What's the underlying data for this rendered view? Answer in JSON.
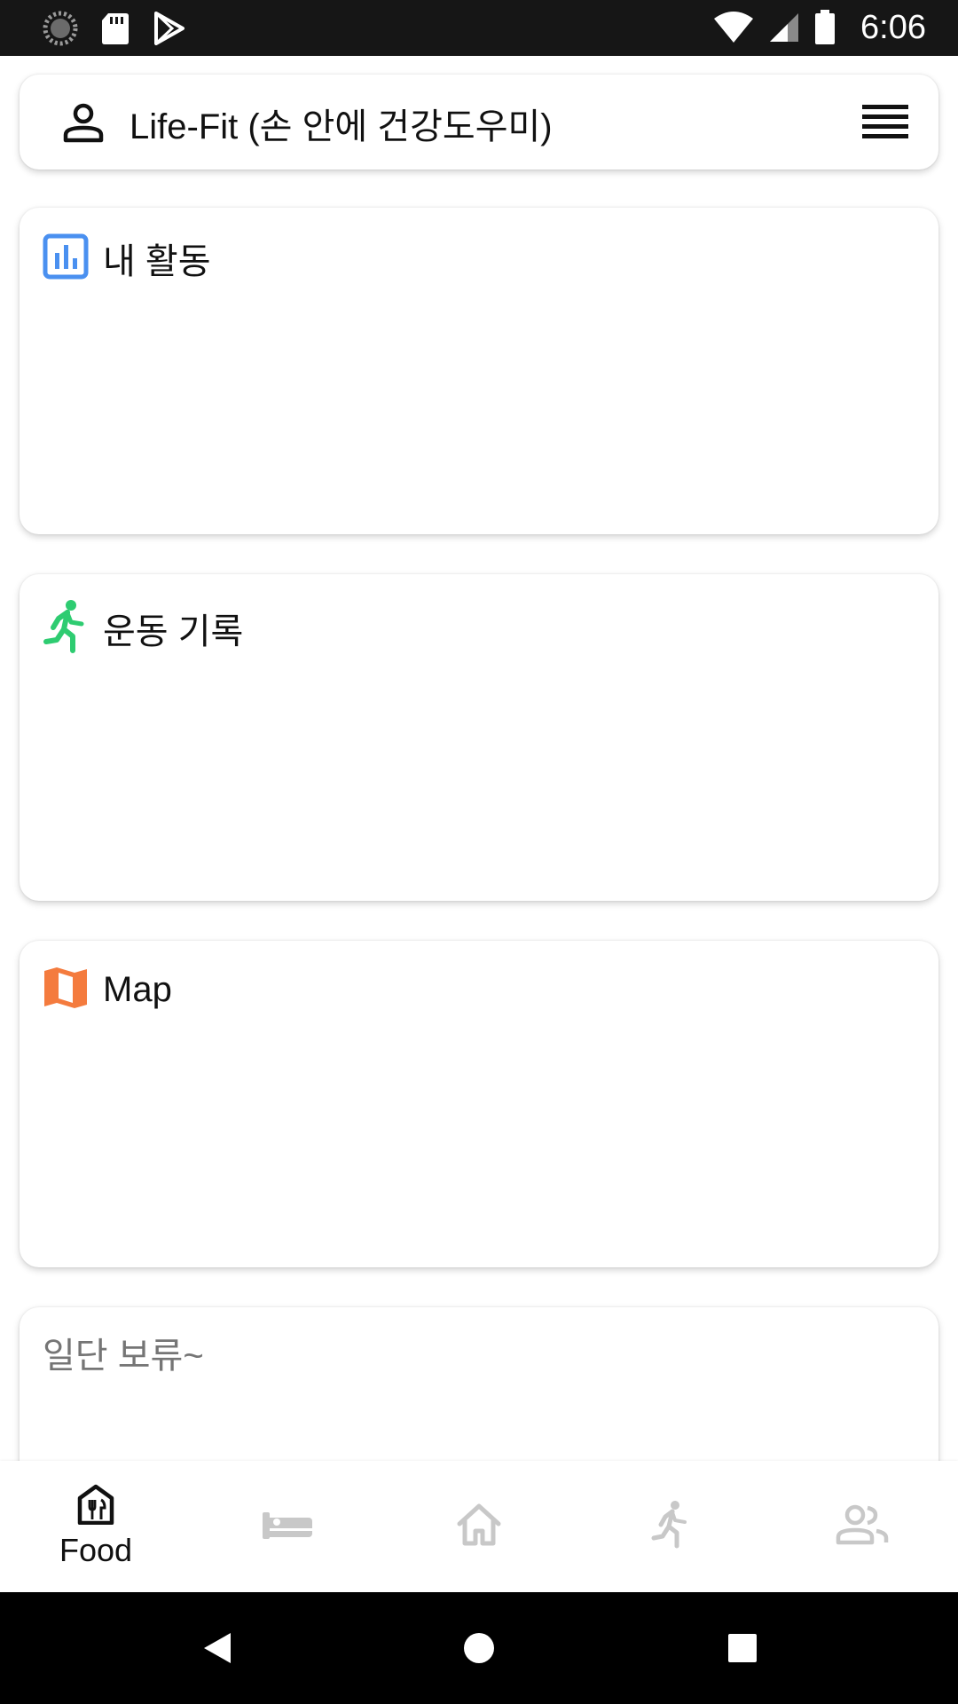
{
  "status_bar": {
    "time": "6:06",
    "icons": [
      "sync-icon",
      "sd-card-icon",
      "play-store-icon",
      "wifi-icon",
      "signal-icon",
      "battery-icon"
    ]
  },
  "header": {
    "title": "Life-Fit (손 안에 건강도우미)",
    "icons": [
      "user-icon",
      "menu-icon"
    ]
  },
  "cards": [
    {
      "title": "내 활동",
      "icon": "bar-chart-icon",
      "icon_color": "#4a90f0"
    },
    {
      "title": "운동 기록",
      "icon": "running-icon",
      "icon_color": "#2ecc71"
    },
    {
      "title": "Map",
      "icon": "map-icon",
      "icon_color": "#f47b3e"
    },
    {
      "title": "일단 보류~",
      "icon": "",
      "text_color": "#757575"
    }
  ],
  "bottom_nav": {
    "items": [
      {
        "label": "Food",
        "icon": "food-icon",
        "active": true
      },
      {
        "label": "",
        "icon": "bed-icon",
        "active": false
      },
      {
        "label": "",
        "icon": "home-icon",
        "active": false
      },
      {
        "label": "",
        "icon": "running-icon",
        "active": false
      },
      {
        "label": "",
        "icon": "people-icon",
        "active": false
      }
    ],
    "active_color": "#111111",
    "inactive_color": "#bdbdbd"
  },
  "system_nav": [
    "back-icon",
    "home-circle-icon",
    "recents-icon"
  ]
}
